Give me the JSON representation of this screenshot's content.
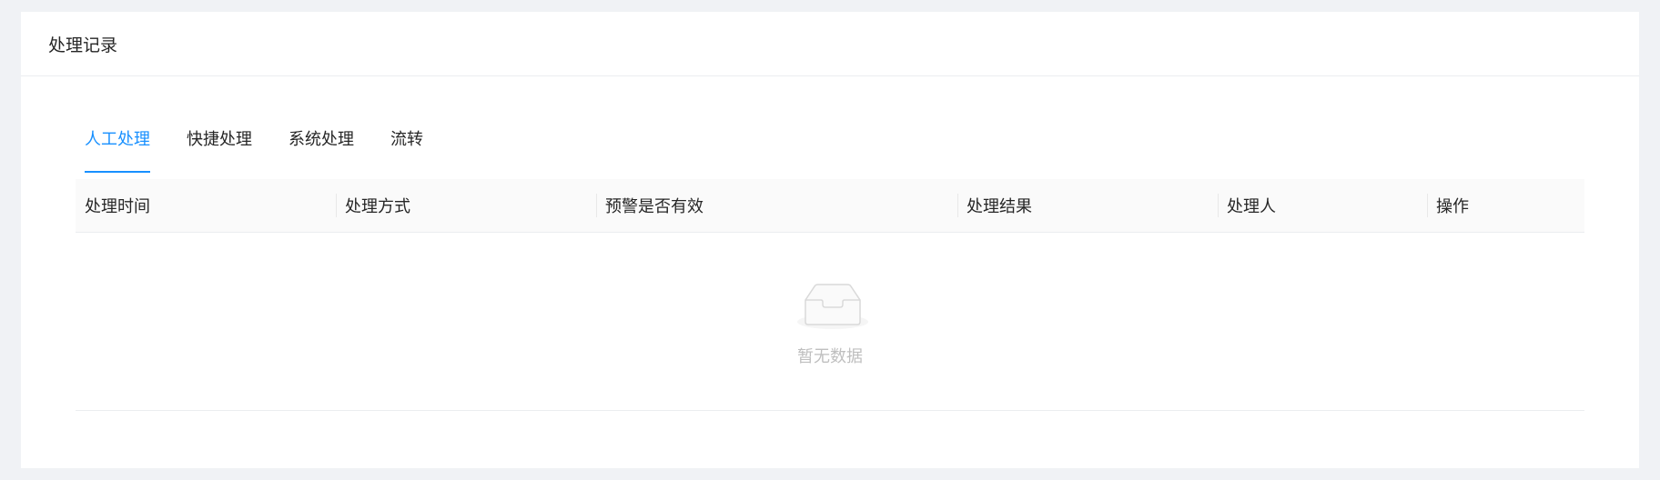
{
  "card": {
    "title": "处理记录"
  },
  "tabs": [
    {
      "label": "人工处理",
      "active": true
    },
    {
      "label": "快捷处理",
      "active": false
    },
    {
      "label": "系统处理",
      "active": false
    },
    {
      "label": "流转",
      "active": false
    }
  ],
  "table": {
    "columns": [
      "处理时间",
      "处理方式",
      "预警是否有效",
      "处理结果",
      "处理人",
      "操作"
    ],
    "rows": [],
    "empty_text": "暂无数据"
  },
  "colors": {
    "accent": "#1890ff",
    "background": "#f0f2f5",
    "header_bg": "#fafafa",
    "empty_text": "#bfbfbf"
  },
  "icons": {
    "empty": "empty-inbox-icon"
  }
}
